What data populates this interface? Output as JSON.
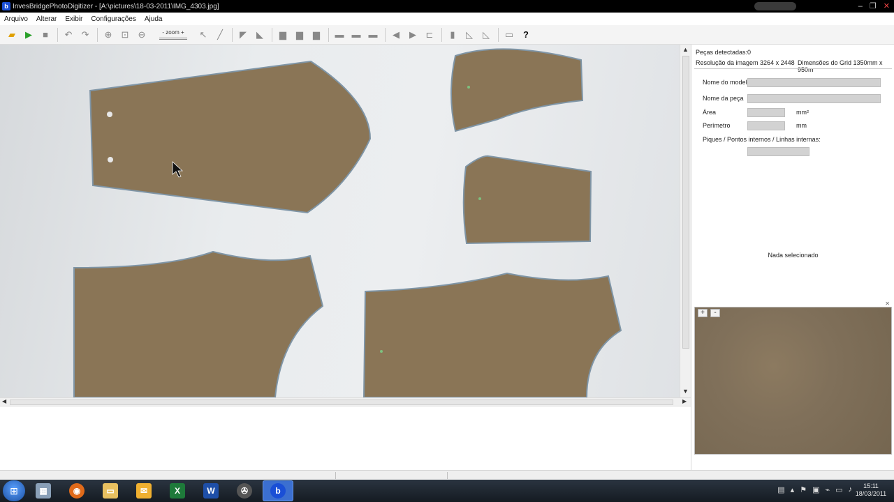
{
  "window": {
    "title": "InvesBridgePhotoDigitizer - [A:\\pictures\\18-03-2011\\IMG_4303.jpg]",
    "app_icon_letter": "b",
    "buttons": {
      "minimize": "–",
      "restore": "❐",
      "close": "✕"
    }
  },
  "menu": [
    "Arquivo",
    "Alterar",
    "Exibir",
    "Configurações",
    "Ajuda"
  ],
  "toolbar": {
    "zoom_label": "zoom",
    "zoom_minus": "-",
    "zoom_plus": "+",
    "help_label": "?"
  },
  "info": {
    "pieces_detected": "Peças detectadas:0",
    "image_resolution": "Resolução da imagem 3264 x 2448",
    "grid_dimensions": "Dimensões do Grid 1350mm x 950m"
  },
  "properties": {
    "model_name_label": "Nome do modelo",
    "model_name_value": "",
    "piece_name_label": "Nome da peça",
    "piece_name_value": "",
    "area_label": "Área",
    "area_value": "",
    "area_unit": "mm²",
    "perimeter_label": "Perímetro",
    "perimeter_value": "",
    "perimeter_unit": "mm",
    "notches_label": "Piques  / Pontos internos / Linhas internas:",
    "notches_value": "",
    "nothing_selected": "Nada selecionado"
  },
  "preview": {
    "zoom_in": "+",
    "zoom_out": "-"
  },
  "clock": {
    "time": "15:11",
    "date": "18/03/2011"
  },
  "colors": {
    "piece_fill": "#8a7556",
    "canvas_bg": "#e6e9eb",
    "taskbar": "#1c242d"
  }
}
